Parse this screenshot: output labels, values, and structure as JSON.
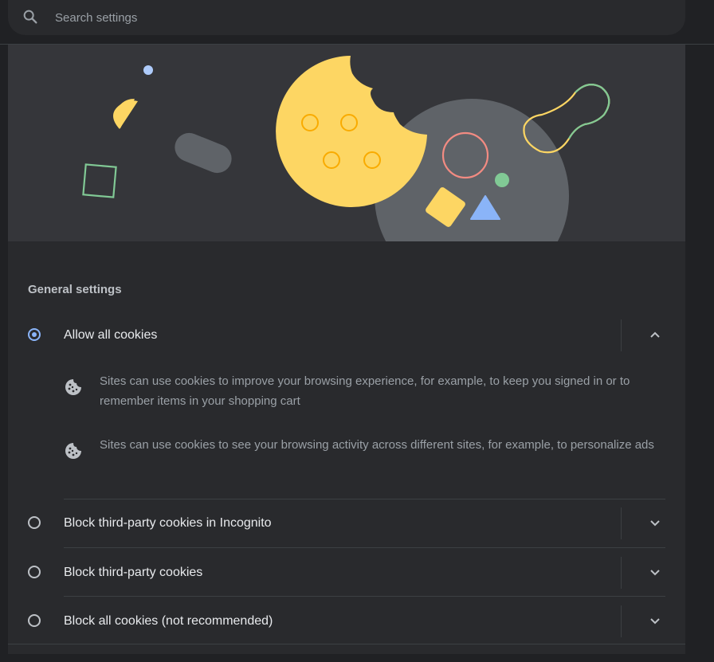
{
  "search": {
    "placeholder": "Search settings"
  },
  "general_settings": {
    "title": "General settings",
    "options": [
      {
        "label": "Allow all cookies",
        "selected": true,
        "expanded": true,
        "descriptions": [
          "Sites can use cookies to improve your browsing experience, for example, to keep you signed in or to remember items in your shopping cart",
          "Sites can use cookies to see your browsing activity across different sites, for example, to personalize ads"
        ]
      },
      {
        "label": "Block third-party cookies in Incognito",
        "selected": false,
        "expanded": false
      },
      {
        "label": "Block third-party cookies",
        "selected": false,
        "expanded": false
      },
      {
        "label": "Block all cookies (not recommended)",
        "selected": false,
        "expanded": false
      }
    ]
  },
  "icons": {
    "search": "search-icon",
    "cookie": "cookie-icon",
    "expand_less": "chevron-up-icon",
    "expand_more": "chevron-down-icon"
  },
  "colors": {
    "accent": "#8ab4f8",
    "cookie_yellow": "#fdd663",
    "background": "#202124",
    "card": "#292a2d"
  }
}
